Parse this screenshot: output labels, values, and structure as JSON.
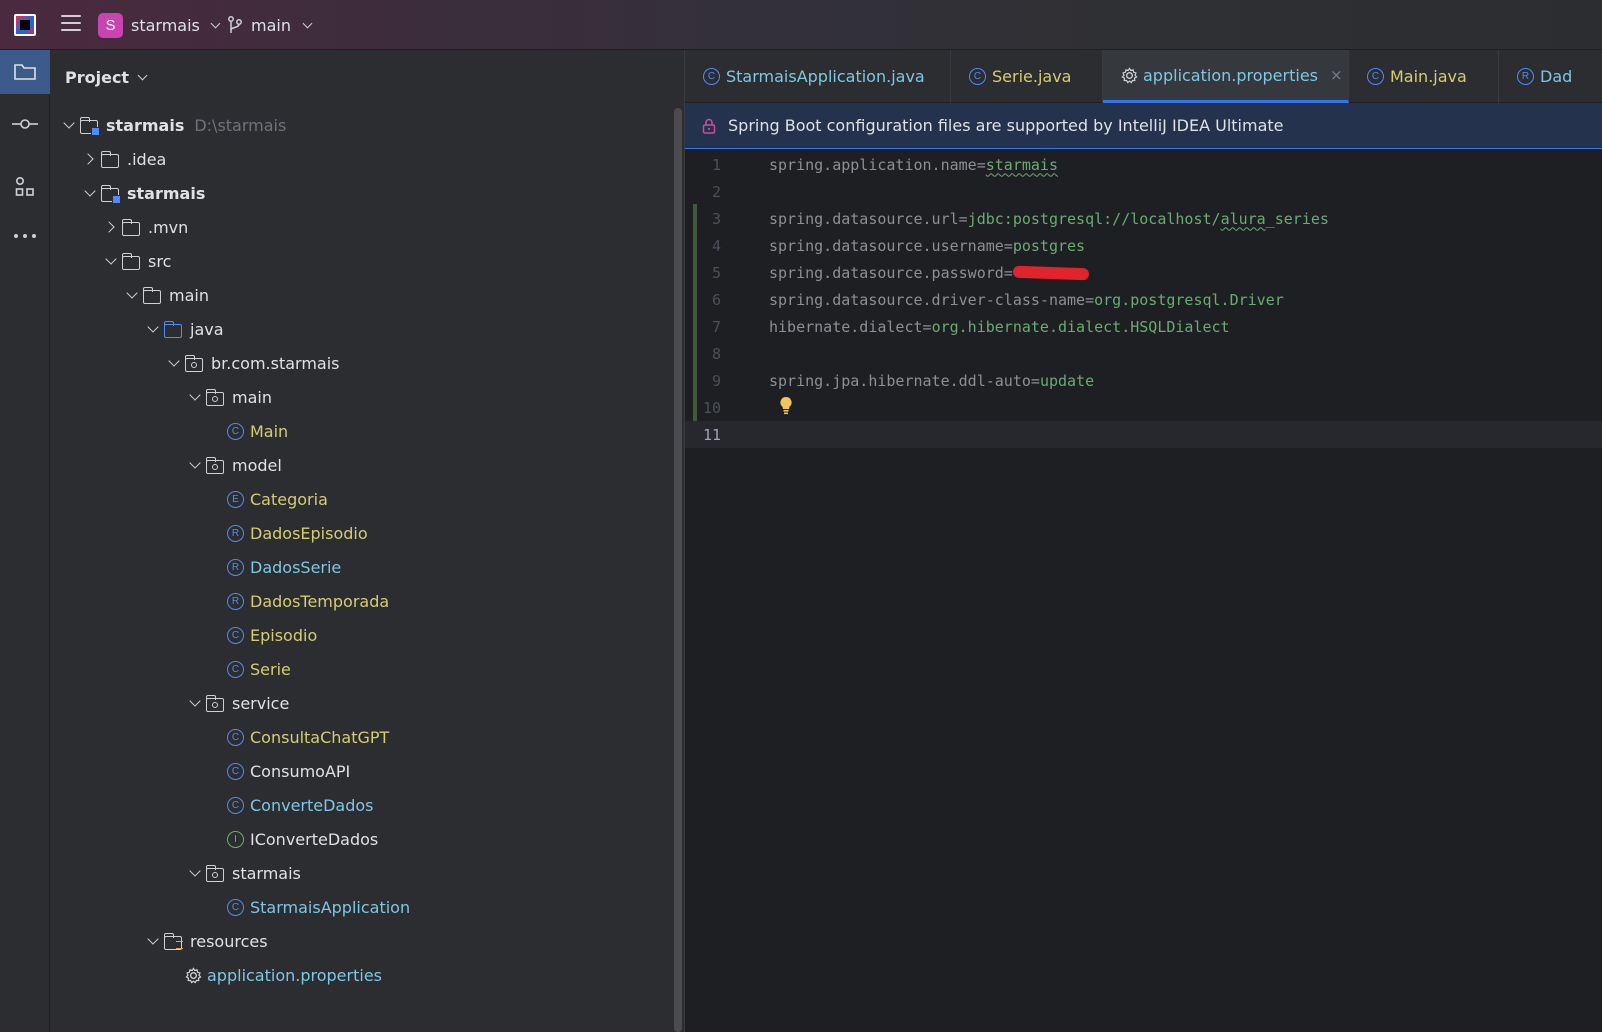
{
  "titlebar": {
    "project_badge": "S",
    "project_name": "starmais",
    "branch_name": "main"
  },
  "toolstrip": {
    "items": [
      "folder-icon",
      "commit-icon",
      "structure-icon",
      "more-icon"
    ]
  },
  "project_panel": {
    "title": "Project",
    "tree": [
      {
        "label": "starmais",
        "extra": "D:\\starmais"
      },
      {
        "label": ".idea"
      },
      {
        "label": "starmais"
      },
      {
        "label": ".mvn"
      },
      {
        "label": "src"
      },
      {
        "label": "main"
      },
      {
        "label": "java"
      },
      {
        "label": "br.com.starmais"
      },
      {
        "label": "main"
      },
      {
        "label": "Main",
        "badge": "C"
      },
      {
        "label": "model"
      },
      {
        "label": "Categoria",
        "badge": "E"
      },
      {
        "label": "DadosEpisodio",
        "badge": "R"
      },
      {
        "label": "DadosSerie",
        "badge": "R"
      },
      {
        "label": "DadosTemporada",
        "badge": "R"
      },
      {
        "label": "Episodio",
        "badge": "C"
      },
      {
        "label": "Serie",
        "badge": "C"
      },
      {
        "label": "service"
      },
      {
        "label": "ConsultaChatGPT",
        "badge": "C"
      },
      {
        "label": "ConsumoAPI",
        "badge": "C"
      },
      {
        "label": "ConverteDados",
        "badge": "C"
      },
      {
        "label": "IConverteDados",
        "badge": "I"
      },
      {
        "label": "starmais"
      },
      {
        "label": "StarmaisApplication",
        "badge": "C"
      },
      {
        "label": "resources"
      },
      {
        "label": "application.properties"
      }
    ]
  },
  "editor": {
    "tabs": [
      {
        "label": "StarmaisApplication.java",
        "badge": "C"
      },
      {
        "label": "Serie.java",
        "badge": "C"
      },
      {
        "label": "application.properties",
        "close": "×"
      },
      {
        "label": "Main.java",
        "badge": "C"
      },
      {
        "label": "Dad",
        "badge": "R"
      }
    ],
    "banner": "Spring Boot configuration files are supported by IntelliJ IDEA Ultimate",
    "lines": [
      {
        "n": "1",
        "key": "spring.application.name=",
        "val": "starmais"
      },
      {
        "n": "2",
        "key": "",
        "val": ""
      },
      {
        "n": "3",
        "key": "spring.datasource.url=",
        "val": "jdbc:postgresql://localhost/",
        "val2": "alura",
        "val3": "_series"
      },
      {
        "n": "4",
        "key": "spring.datasource.username=",
        "val": "postgres"
      },
      {
        "n": "5",
        "key": "spring.datasource.password=",
        "val": ""
      },
      {
        "n": "6",
        "key": "spring.datasource.driver-class-name=",
        "val": "org.postgresql.Driver"
      },
      {
        "n": "7",
        "key": "hibernate.dialect=",
        "val": "org.hibernate.dialect.HSQLDialect"
      },
      {
        "n": "8",
        "key": "",
        "val": ""
      },
      {
        "n": "9",
        "key": "spring.jpa.hibernate.ddl-auto=",
        "val": "update"
      },
      {
        "n": "10",
        "key": "",
        "val": ""
      },
      {
        "n": "11",
        "key": "",
        "val": ""
      }
    ]
  },
  "colors": {
    "accent": "#3574f0",
    "class_yellow": "#d5cd73",
    "class_cyan": "#7fc7e2",
    "value_green": "#6aab73",
    "badge_purple": "#c844b0"
  }
}
